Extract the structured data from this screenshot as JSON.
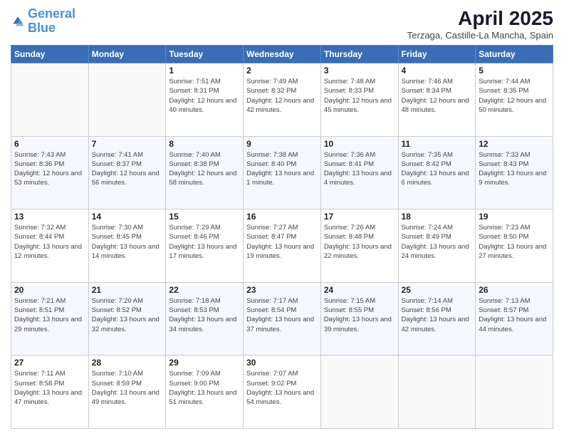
{
  "logo": {
    "line1": "General",
    "line2": "Blue"
  },
  "title": "April 2025",
  "subtitle": "Terzaga, Castille-La Mancha, Spain",
  "weekdays": [
    "Sunday",
    "Monday",
    "Tuesday",
    "Wednesday",
    "Thursday",
    "Friday",
    "Saturday"
  ],
  "weeks": [
    [
      {
        "day": "",
        "info": ""
      },
      {
        "day": "",
        "info": ""
      },
      {
        "day": "1",
        "info": "Sunrise: 7:51 AM\nSunset: 8:31 PM\nDaylight: 12 hours and 40 minutes."
      },
      {
        "day": "2",
        "info": "Sunrise: 7:49 AM\nSunset: 8:32 PM\nDaylight: 12 hours and 42 minutes."
      },
      {
        "day": "3",
        "info": "Sunrise: 7:48 AM\nSunset: 8:33 PM\nDaylight: 12 hours and 45 minutes."
      },
      {
        "day": "4",
        "info": "Sunrise: 7:46 AM\nSunset: 8:34 PM\nDaylight: 12 hours and 48 minutes."
      },
      {
        "day": "5",
        "info": "Sunrise: 7:44 AM\nSunset: 8:35 PM\nDaylight: 12 hours and 50 minutes."
      }
    ],
    [
      {
        "day": "6",
        "info": "Sunrise: 7:43 AM\nSunset: 8:36 PM\nDaylight: 12 hours and 53 minutes."
      },
      {
        "day": "7",
        "info": "Sunrise: 7:41 AM\nSunset: 8:37 PM\nDaylight: 12 hours and 56 minutes."
      },
      {
        "day": "8",
        "info": "Sunrise: 7:40 AM\nSunset: 8:38 PM\nDaylight: 12 hours and 58 minutes."
      },
      {
        "day": "9",
        "info": "Sunrise: 7:38 AM\nSunset: 8:40 PM\nDaylight: 13 hours and 1 minute."
      },
      {
        "day": "10",
        "info": "Sunrise: 7:36 AM\nSunset: 8:41 PM\nDaylight: 13 hours and 4 minutes."
      },
      {
        "day": "11",
        "info": "Sunrise: 7:35 AM\nSunset: 8:42 PM\nDaylight: 13 hours and 6 minutes."
      },
      {
        "day": "12",
        "info": "Sunrise: 7:33 AM\nSunset: 8:43 PM\nDaylight: 13 hours and 9 minutes."
      }
    ],
    [
      {
        "day": "13",
        "info": "Sunrise: 7:32 AM\nSunset: 8:44 PM\nDaylight: 13 hours and 12 minutes."
      },
      {
        "day": "14",
        "info": "Sunrise: 7:30 AM\nSunset: 8:45 PM\nDaylight: 13 hours and 14 minutes."
      },
      {
        "day": "15",
        "info": "Sunrise: 7:29 AM\nSunset: 8:46 PM\nDaylight: 13 hours and 17 minutes."
      },
      {
        "day": "16",
        "info": "Sunrise: 7:27 AM\nSunset: 8:47 PM\nDaylight: 13 hours and 19 minutes."
      },
      {
        "day": "17",
        "info": "Sunrise: 7:26 AM\nSunset: 8:48 PM\nDaylight: 13 hours and 22 minutes."
      },
      {
        "day": "18",
        "info": "Sunrise: 7:24 AM\nSunset: 8:49 PM\nDaylight: 13 hours and 24 minutes."
      },
      {
        "day": "19",
        "info": "Sunrise: 7:23 AM\nSunset: 8:50 PM\nDaylight: 13 hours and 27 minutes."
      }
    ],
    [
      {
        "day": "20",
        "info": "Sunrise: 7:21 AM\nSunset: 8:51 PM\nDaylight: 13 hours and 29 minutes."
      },
      {
        "day": "21",
        "info": "Sunrise: 7:20 AM\nSunset: 8:52 PM\nDaylight: 13 hours and 32 minutes."
      },
      {
        "day": "22",
        "info": "Sunrise: 7:18 AM\nSunset: 8:53 PM\nDaylight: 13 hours and 34 minutes."
      },
      {
        "day": "23",
        "info": "Sunrise: 7:17 AM\nSunset: 8:54 PM\nDaylight: 13 hours and 37 minutes."
      },
      {
        "day": "24",
        "info": "Sunrise: 7:15 AM\nSunset: 8:55 PM\nDaylight: 13 hours and 39 minutes."
      },
      {
        "day": "25",
        "info": "Sunrise: 7:14 AM\nSunset: 8:56 PM\nDaylight: 13 hours and 42 minutes."
      },
      {
        "day": "26",
        "info": "Sunrise: 7:13 AM\nSunset: 8:57 PM\nDaylight: 13 hours and 44 minutes."
      }
    ],
    [
      {
        "day": "27",
        "info": "Sunrise: 7:11 AM\nSunset: 8:58 PM\nDaylight: 13 hours and 47 minutes."
      },
      {
        "day": "28",
        "info": "Sunrise: 7:10 AM\nSunset: 8:59 PM\nDaylight: 13 hours and 49 minutes."
      },
      {
        "day": "29",
        "info": "Sunrise: 7:09 AM\nSunset: 9:00 PM\nDaylight: 13 hours and 51 minutes."
      },
      {
        "day": "30",
        "info": "Sunrise: 7:07 AM\nSunset: 9:02 PM\nDaylight: 13 hours and 54 minutes."
      },
      {
        "day": "",
        "info": ""
      },
      {
        "day": "",
        "info": ""
      },
      {
        "day": "",
        "info": ""
      }
    ]
  ]
}
